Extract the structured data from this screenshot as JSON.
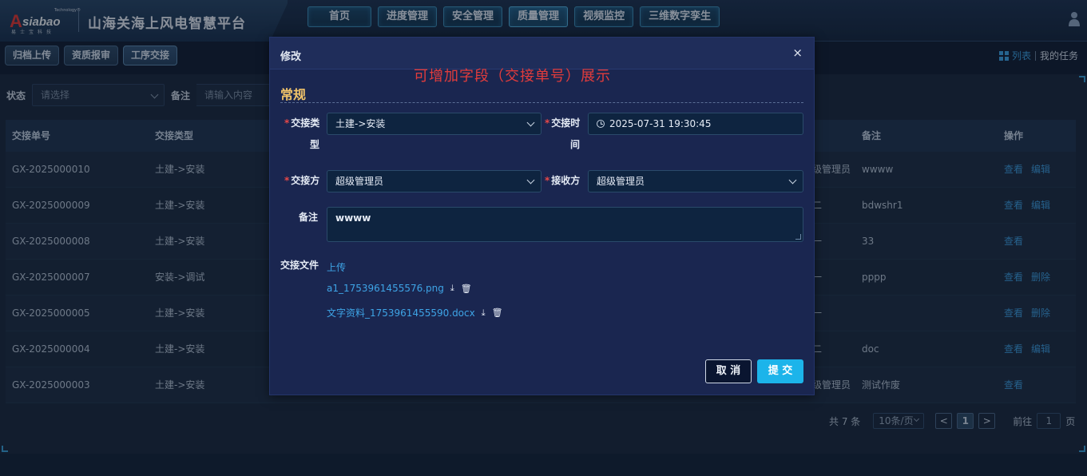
{
  "header": {
    "logo_tech": "Technology®",
    "logo_a": "A",
    "logo_word": "siabao",
    "logo_sub": "易士宝科技",
    "platform_title": "山海关海上风电智慧平台",
    "nav": [
      {
        "label": "首页"
      },
      {
        "label": "进度管理"
      },
      {
        "label": "安全管理"
      },
      {
        "label": "质量管理"
      },
      {
        "label": "视频监控"
      },
      {
        "label": "三维数字孪生"
      }
    ]
  },
  "subbar": {
    "tabs": [
      {
        "label": "归档上传"
      },
      {
        "label": "资质报审"
      },
      {
        "label": "工序交接"
      }
    ],
    "view_list": "列表",
    "my_tasks": "我的任务"
  },
  "filters": {
    "status_label": "状态",
    "status_placeholder": "请选择",
    "remark_label": "备注",
    "remark_placeholder": "请输入内容"
  },
  "table": {
    "headers": {
      "code": "交接单号",
      "type": "交接类型",
      "remark": "备注",
      "ops": "操作"
    },
    "rows": [
      {
        "code": "GX-2025000010",
        "type": "土建->安装",
        "party": "级管理员",
        "remark": "wwww",
        "op1": "查看",
        "op2": "编辑"
      },
      {
        "code": "GX-2025000009",
        "type": "土建->安装",
        "party": "二",
        "remark": "bdwshr1",
        "op1": "查看",
        "op2": "编辑"
      },
      {
        "code": "GX-2025000008",
        "type": "土建->安装",
        "party": "一",
        "remark": "33",
        "op1": "查看",
        "op2": ""
      },
      {
        "code": "GX-2025000007",
        "type": "安装->调试",
        "party": "一",
        "remark": "pppp",
        "op1": "查看",
        "op2": "删除"
      },
      {
        "code": "GX-2025000005",
        "type": "土建->安装",
        "party": "一",
        "remark": "",
        "op1": "查看",
        "op2": "删除"
      },
      {
        "code": "GX-2025000004",
        "type": "土建->安装",
        "party": "二",
        "remark": "doc",
        "op1": "查看",
        "op2": "编辑"
      },
      {
        "code": "GX-2025000003",
        "type": "土建->安装",
        "party": "级管理员",
        "remark": "测试作废",
        "op1": "查看",
        "op2": ""
      }
    ]
  },
  "pager": {
    "total": "共 7 条",
    "page_size": "10条/页",
    "prev": "<",
    "current": "1",
    "next": ">",
    "goto_label": "前往",
    "goto_value": "1",
    "page_unit": "页"
  },
  "modal": {
    "title": "修改",
    "close": "×",
    "note": "可增加字段（交接单号）展示",
    "section": "常规",
    "fields": {
      "type_label_1": "交接类",
      "type_label_2": "型",
      "type_value": "土建->安装",
      "time_label_1": "交接时",
      "time_label_2": "间",
      "time_value": "2025-07-31 19:30:45",
      "from_label": "交接方",
      "from_value": "超级管理员",
      "to_label": "接收方",
      "to_value": "超级管理员",
      "remark_label": "备注",
      "remark_value": "wwww",
      "files_label": "交接文件",
      "upload": "上传",
      "required_mark": "*"
    },
    "files": [
      {
        "name": "a1_1753961455576.png"
      },
      {
        "name": "文字资料_1753961455590.docx"
      }
    ],
    "cancel": "取 消",
    "submit": "提 交"
  },
  "icons": {
    "download": "⤓",
    "delete": "🗑"
  },
  "colors": {
    "accent": "#1cb4ea",
    "link": "#3ea4e6",
    "note_red": "#e23c3c",
    "section_gold": "#f2c46a"
  }
}
